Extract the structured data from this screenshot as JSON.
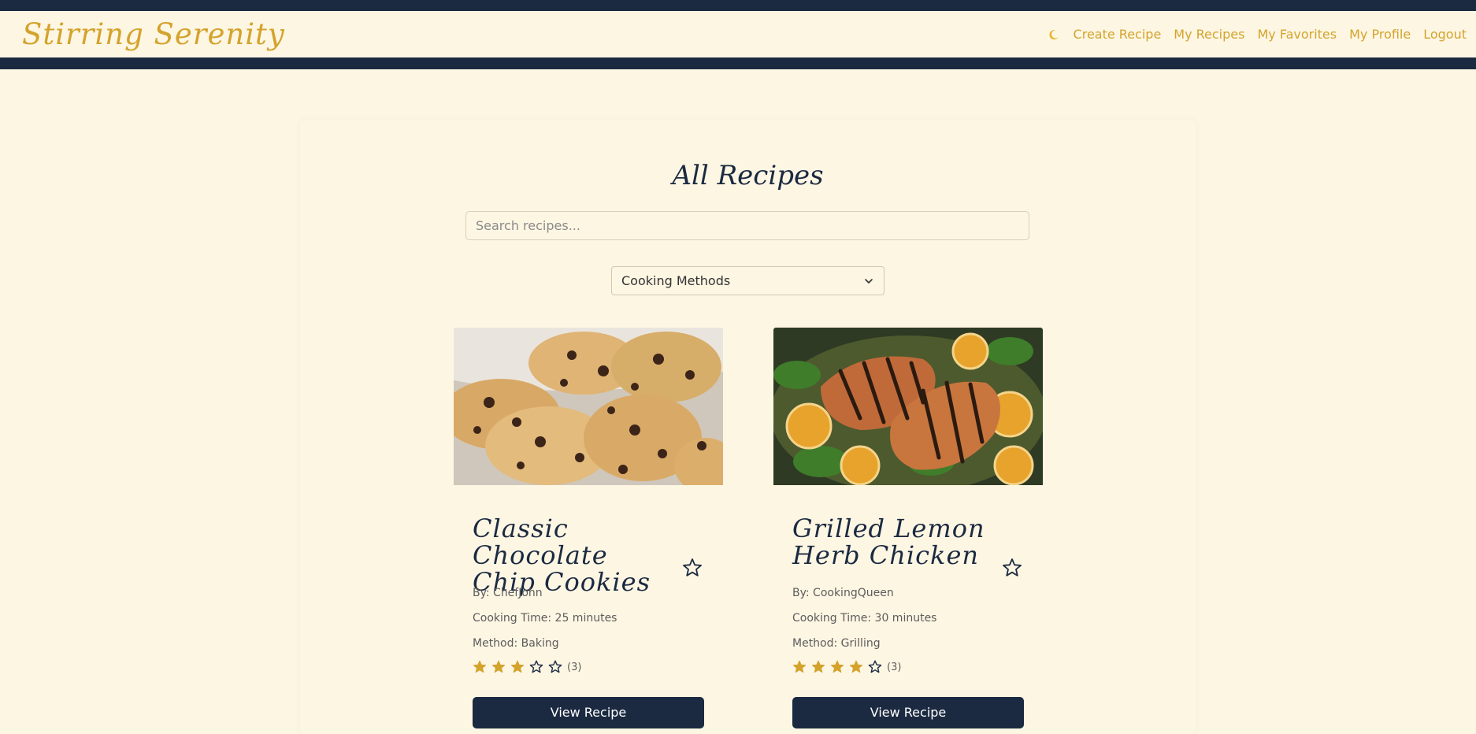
{
  "colors": {
    "navy": "#1b2a41",
    "gold": "#d4a32c",
    "cream": "#fdf6e3"
  },
  "navbar": {
    "brand": "Stirring Serenity",
    "theme_toggle_icon": "moon-icon",
    "links": [
      {
        "label": "Create Recipe"
      },
      {
        "label": "My Recipes"
      },
      {
        "label": "My Favorites"
      },
      {
        "label": "My Profile"
      },
      {
        "label": "Logout"
      }
    ]
  },
  "main": {
    "title": "All Recipes",
    "search": {
      "placeholder": "Search recipes...",
      "value": ""
    },
    "filter": {
      "selected": "Cooking Methods"
    },
    "recipes": [
      {
        "title": "Classic Chocolate Chip Cookies",
        "image": "chocolate-chip-cookies-photo",
        "author": "By: ChefJohn",
        "cooking_time": "Cooking Time: 25 minutes",
        "method": "Method: Baking",
        "rating": 3,
        "rating_max": 5,
        "rating_count": "(3)",
        "button": "View Recipe"
      },
      {
        "title": "Grilled Lemon Herb Chicken",
        "image": "grilled-lemon-chicken-photo",
        "author": "By: CookingQueen",
        "cooking_time": "Cooking Time: 30 minutes",
        "method": "Method: Grilling",
        "rating": 4,
        "rating_max": 5,
        "rating_count": "(3)",
        "button": "View Recipe"
      }
    ]
  }
}
